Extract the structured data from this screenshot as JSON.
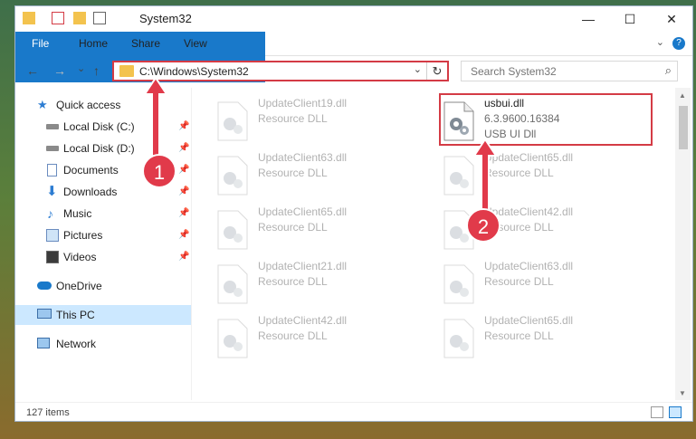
{
  "window": {
    "title": "System32",
    "minimize_glyph": "—",
    "maximize_glyph": "☐",
    "close_glyph": "✕"
  },
  "ribbon": {
    "tabs": [
      "File",
      "Home",
      "Share",
      "View"
    ],
    "expand_glyph": "⌄",
    "help_glyph": "?"
  },
  "nav": {
    "back_glyph": "←",
    "forward_glyph": "→",
    "recent_glyph": "⌄",
    "up_glyph": "↑",
    "address": "C:\\Windows\\System32",
    "dropdown_glyph": "⌄",
    "refresh_glyph": "↻"
  },
  "search": {
    "placeholder": "Search System32",
    "icon_glyph": "⌕"
  },
  "sidebar": {
    "items": [
      {
        "label": "Quick access",
        "icon": "star-icon",
        "pinned": false
      },
      {
        "label": "Local Disk (C:)",
        "icon": "drive-icon",
        "pinned": true
      },
      {
        "label": "Local Disk (D:)",
        "icon": "drive-icon",
        "pinned": true
      },
      {
        "label": "Documents",
        "icon": "documents-icon",
        "pinned": true
      },
      {
        "label": "Downloads",
        "icon": "download-icon",
        "pinned": true
      },
      {
        "label": "Music",
        "icon": "music-icon",
        "pinned": true
      },
      {
        "label": "Pictures",
        "icon": "pictures-icon",
        "pinned": true
      },
      {
        "label": "Videos",
        "icon": "videos-icon",
        "pinned": true
      },
      {
        "label": "OneDrive",
        "icon": "cloud-icon",
        "pinned": false
      },
      {
        "label": "This PC",
        "icon": "computer-icon",
        "pinned": false
      },
      {
        "label": "Network",
        "icon": "network-icon",
        "pinned": false
      }
    ],
    "pin_glyph": "📌"
  },
  "files": [
    {
      "name": "UpdateClient19.dll",
      "type": "Resource DLL"
    },
    {
      "name": "usbui.dll",
      "type": "6.3.9600.16384",
      "desc": "USB UI Dll"
    },
    {
      "name": "UpdateClient63.dll",
      "type": "Resource DLL"
    },
    {
      "name": "UpdateClient65.dll",
      "type": "Resource DLL"
    },
    {
      "name": "UpdateClient65.dll",
      "type": "Resource DLL"
    },
    {
      "name": "UpdateClient42.dll",
      "type": "Resource DLL"
    },
    {
      "name": "UpdateClient21.dll",
      "type": "Resource DLL"
    },
    {
      "name": "UpdateClient63.dll",
      "type": "Resource DLL"
    },
    {
      "name": "UpdateClient42.dll",
      "type": "Resource DLL"
    },
    {
      "name": "UpdateClient65.dll",
      "type": "Resource DLL"
    }
  ],
  "status": {
    "count": "127 items"
  },
  "annotations": {
    "step1": "1",
    "step2": "2",
    "color": "#e13a4a"
  }
}
